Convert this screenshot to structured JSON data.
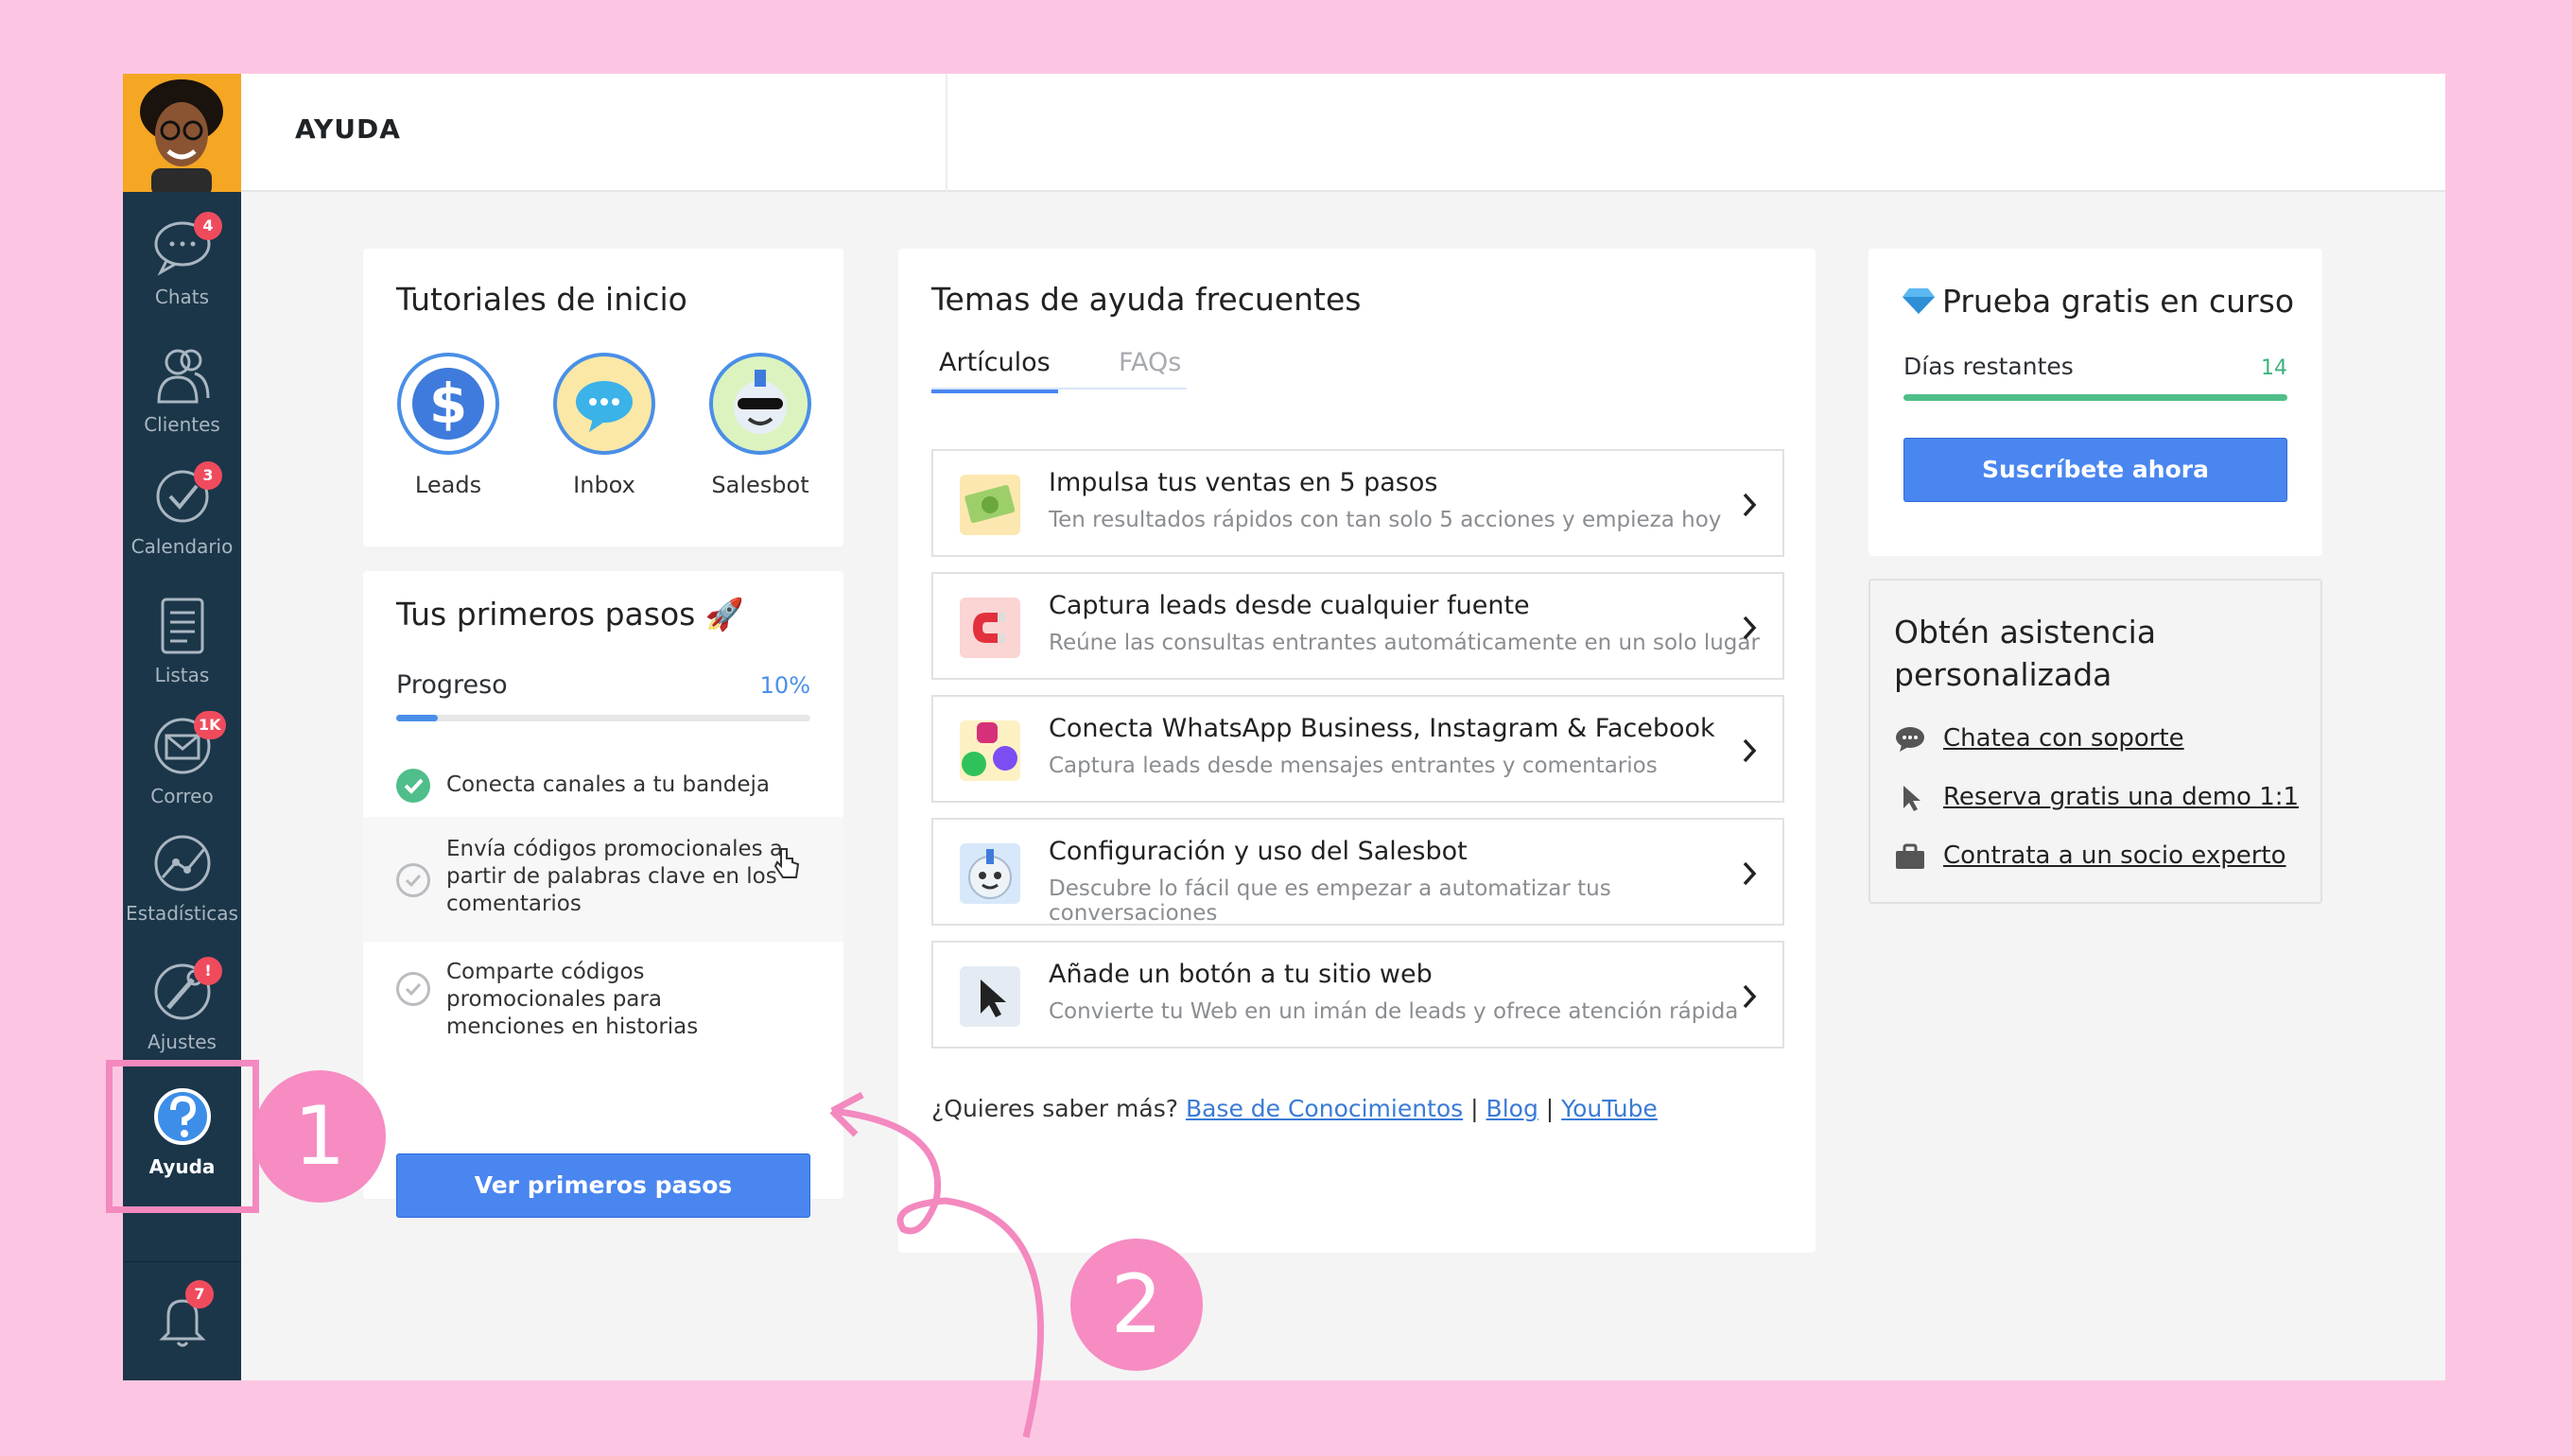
{
  "sidebar": {
    "items": [
      {
        "label": "Chats",
        "badge": "4",
        "icon": "chat-bubble-icon"
      },
      {
        "label": "Clientes",
        "badge": "",
        "icon": "users-icon"
      },
      {
        "label": "Calendario",
        "badge": "3",
        "icon": "checkmark-icon"
      },
      {
        "label": "Listas",
        "badge": "",
        "icon": "list-icon"
      },
      {
        "label": "Correo",
        "badge": "1K",
        "icon": "mail-icon"
      },
      {
        "label": "Estadísticas",
        "badge": "",
        "icon": "stats-icon"
      },
      {
        "label": "Ajustes",
        "badge": "!",
        "icon": "settings-icon"
      },
      {
        "label": "Ayuda",
        "badge": "",
        "icon": "help-icon"
      }
    ],
    "bell_badge": "7"
  },
  "header": {
    "title": "AYUDA"
  },
  "tutorials": {
    "title": "Tutoriales de inicio",
    "items": [
      {
        "label": "Leads",
        "icon": "dollar-icon"
      },
      {
        "label": "Inbox",
        "icon": "chat-icon"
      },
      {
        "label": "Salesbot",
        "icon": "bot-icon"
      }
    ]
  },
  "first_steps": {
    "title": "Tus primeros pasos 🚀",
    "progress_label": "Progreso",
    "progress_value": "10%",
    "progress_fraction": 0.1,
    "steps": [
      {
        "text": "Conecta canales a tu bandeja",
        "done": true
      },
      {
        "text": "Envía códigos promocionales a partir de palabras clave en los comentarios",
        "done": false
      },
      {
        "text": "Comparte códigos promocionales para menciones en historias",
        "done": false
      }
    ],
    "button": "Ver primeros pasos"
  },
  "help_topics": {
    "title": "Temas de ayuda frecuentes",
    "tabs": [
      "Artículos",
      "FAQs"
    ],
    "articles": [
      {
        "title": "Impulsa tus ventas en 5 pasos",
        "subtitle": "Ten resultados rápidos con tan solo 5 acciones y empieza hoy"
      },
      {
        "title": "Captura leads desde cualquier fuente",
        "subtitle": "Reúne las consultas entrantes automáticamente en un solo lugar"
      },
      {
        "title": "Conecta WhatsApp Business, Instagram & Facebook",
        "subtitle": "Captura leads desde mensajes entrantes y comentarios"
      },
      {
        "title": "Configuración y uso del Salesbot",
        "subtitle": "Descubre lo fácil que es empezar a automatizar tus conversaciones"
      },
      {
        "title": "Añade un botón a tu sitio web",
        "subtitle": "Convierte tu Web en un imán de leads y ofrece atención rápida"
      }
    ],
    "more_prefix": "¿Quieres saber más?",
    "links": [
      "Base de Conocimientos",
      "Blog",
      "YouTube"
    ],
    "sep": "|"
  },
  "trial": {
    "title": "Prueba gratis en curso",
    "days_label": "Días restantes",
    "days_value": "14",
    "button": "Suscríbete ahora"
  },
  "assist": {
    "title_line1": "Obtén asistencia",
    "title_line2": "personalizada",
    "links": [
      "Chatea con soporte",
      "Reserva gratis una demo 1:1",
      "Contrata a un socio experto"
    ]
  },
  "annotations": [
    "1",
    "2"
  ],
  "colors": {
    "accent": "#4a86f0",
    "sidebar": "#1b3649",
    "annotation": "#f68cc2",
    "badge": "#f04b5d"
  }
}
